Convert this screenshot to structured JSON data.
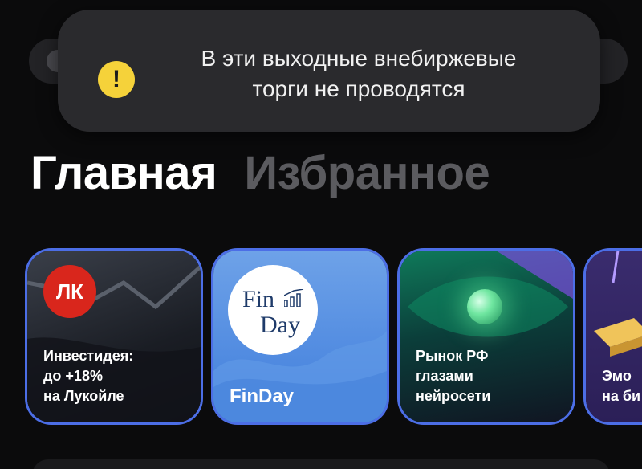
{
  "toast": {
    "message_line1": "В эти выходные внебиржевые",
    "message_line2": "торги не проводятся",
    "icon": "warning-icon",
    "icon_glyph": "!",
    "icon_color": "#f5d23a"
  },
  "tabs": [
    {
      "label": "Главная",
      "active": true
    },
    {
      "label": "Избранное",
      "active": false
    }
  ],
  "stories": [
    {
      "lines": [
        "Инвестидея:",
        "до +18%",
        "на Лукойле"
      ],
      "logo_text": "ЛК"
    },
    {
      "lines": [
        "FinDay"
      ],
      "logo_word1": "Fin",
      "logo_word2": "Day"
    },
    {
      "lines": [
        "Рынок РФ",
        "глазами",
        "нейросети"
      ]
    },
    {
      "lines": [
        "Эмо",
        "на би"
      ]
    }
  ],
  "colors": {
    "background": "#0b0b0c",
    "toast_bg": "#2a2a2d",
    "active_tab": "#ffffff",
    "inactive_tab": "#5b5b5f",
    "story_ring": "#4c6ee6"
  }
}
